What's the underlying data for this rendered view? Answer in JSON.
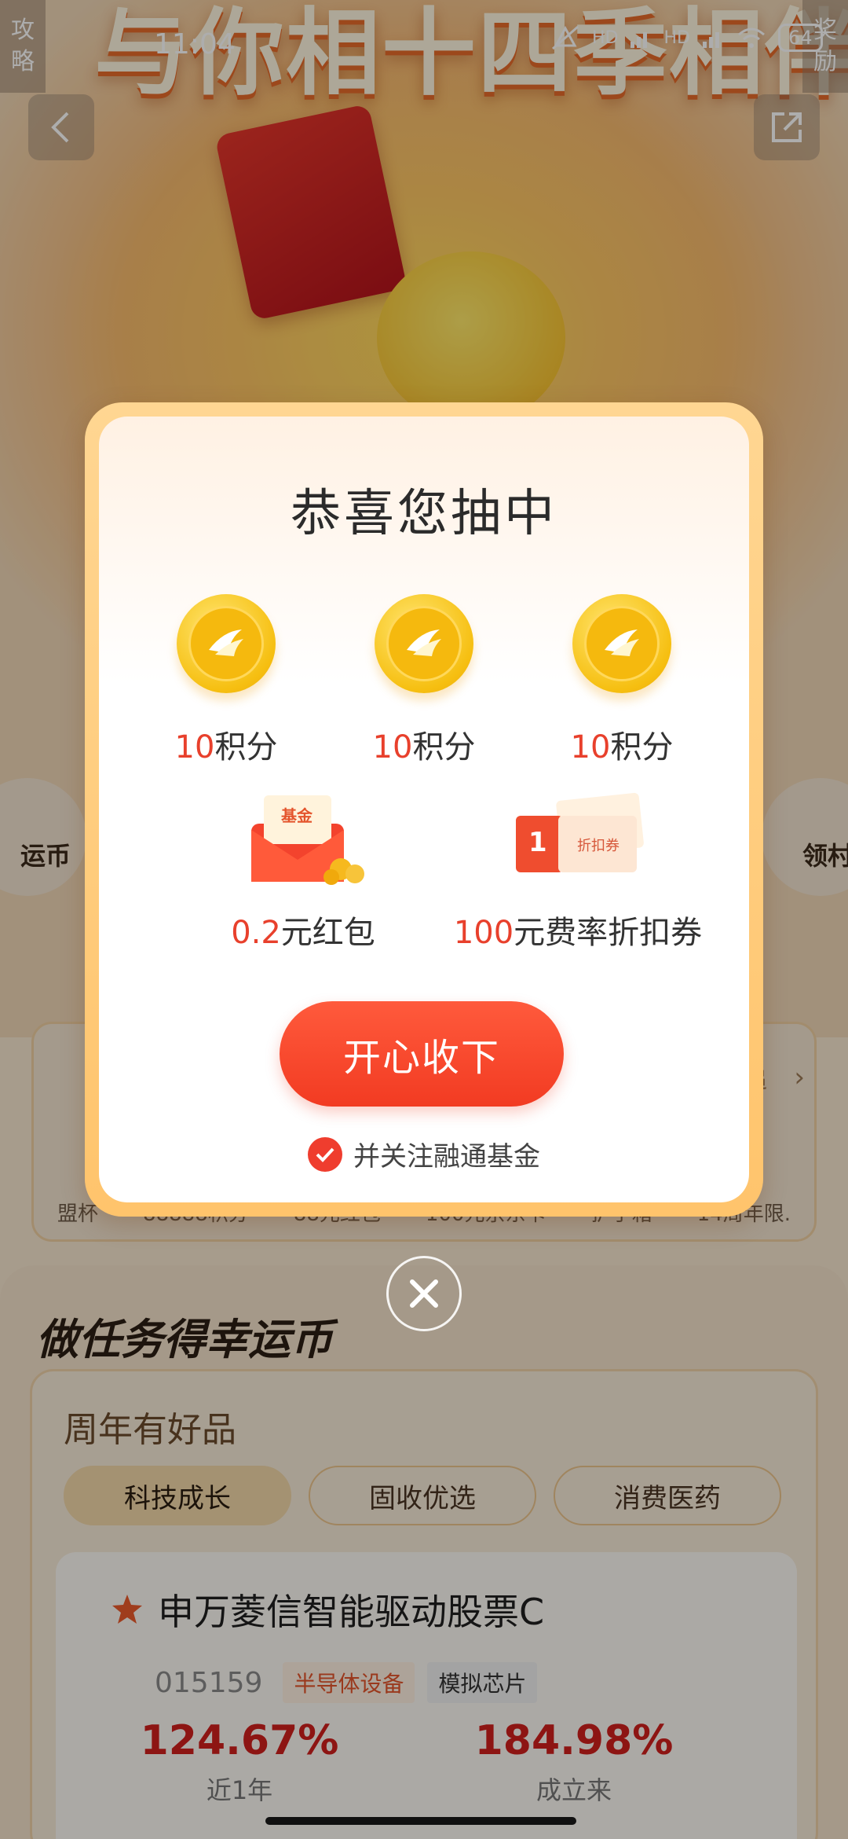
{
  "status_bar": {
    "time": "11:04",
    "battery": "64",
    "net_labels": [
      "HD",
      "HD"
    ]
  },
  "side_tabs": {
    "left": [
      "攻",
      "略"
    ],
    "right": [
      "奖",
      "励"
    ]
  },
  "hero": {
    "title": "与你相十四季相伴"
  },
  "side_bubbles": {
    "left": "运币",
    "right": "领村"
  },
  "prize_strip": {
    "captions": [
      "盟杯",
      "88888积分",
      "88元红包",
      "100元京东卡",
      "护手箱",
      "14周年限."
    ],
    "more": "›",
    "more_label": "追"
  },
  "task_section": {
    "title": "做任务得幸运币",
    "card_title": "周年有好品",
    "tabs": [
      "科技成长",
      "固收优选",
      "消费医药"
    ],
    "fund": {
      "name": "申万菱信智能驱动股票C",
      "code": "015159",
      "tags": [
        "半导体设备",
        "模拟芯片"
      ],
      "stat1_value": "124.67%",
      "stat1_label": "近1年",
      "stat2_value": "184.98%",
      "stat2_label": "成立来"
    }
  },
  "dialog": {
    "title": "恭喜您抽中",
    "coins": [
      {
        "num": "10",
        "unit": "积分"
      },
      {
        "num": "10",
        "unit": "积分"
      },
      {
        "num": "10",
        "unit": "积分"
      }
    ],
    "redpack": {
      "num": "0.2",
      "unit": "元红包",
      "icon_text": "基金"
    },
    "coupon": {
      "num": "100",
      "unit": "元费率折扣券",
      "icon_badge": "1",
      "icon_text": "折扣券"
    },
    "accept_label": "开心收下",
    "follow_label": "并关注融通基金",
    "follow_checked": true
  },
  "colors": {
    "accent_red": "#ef3d2e",
    "prize_number": "#e8402c",
    "gold": "#f6bf11"
  }
}
